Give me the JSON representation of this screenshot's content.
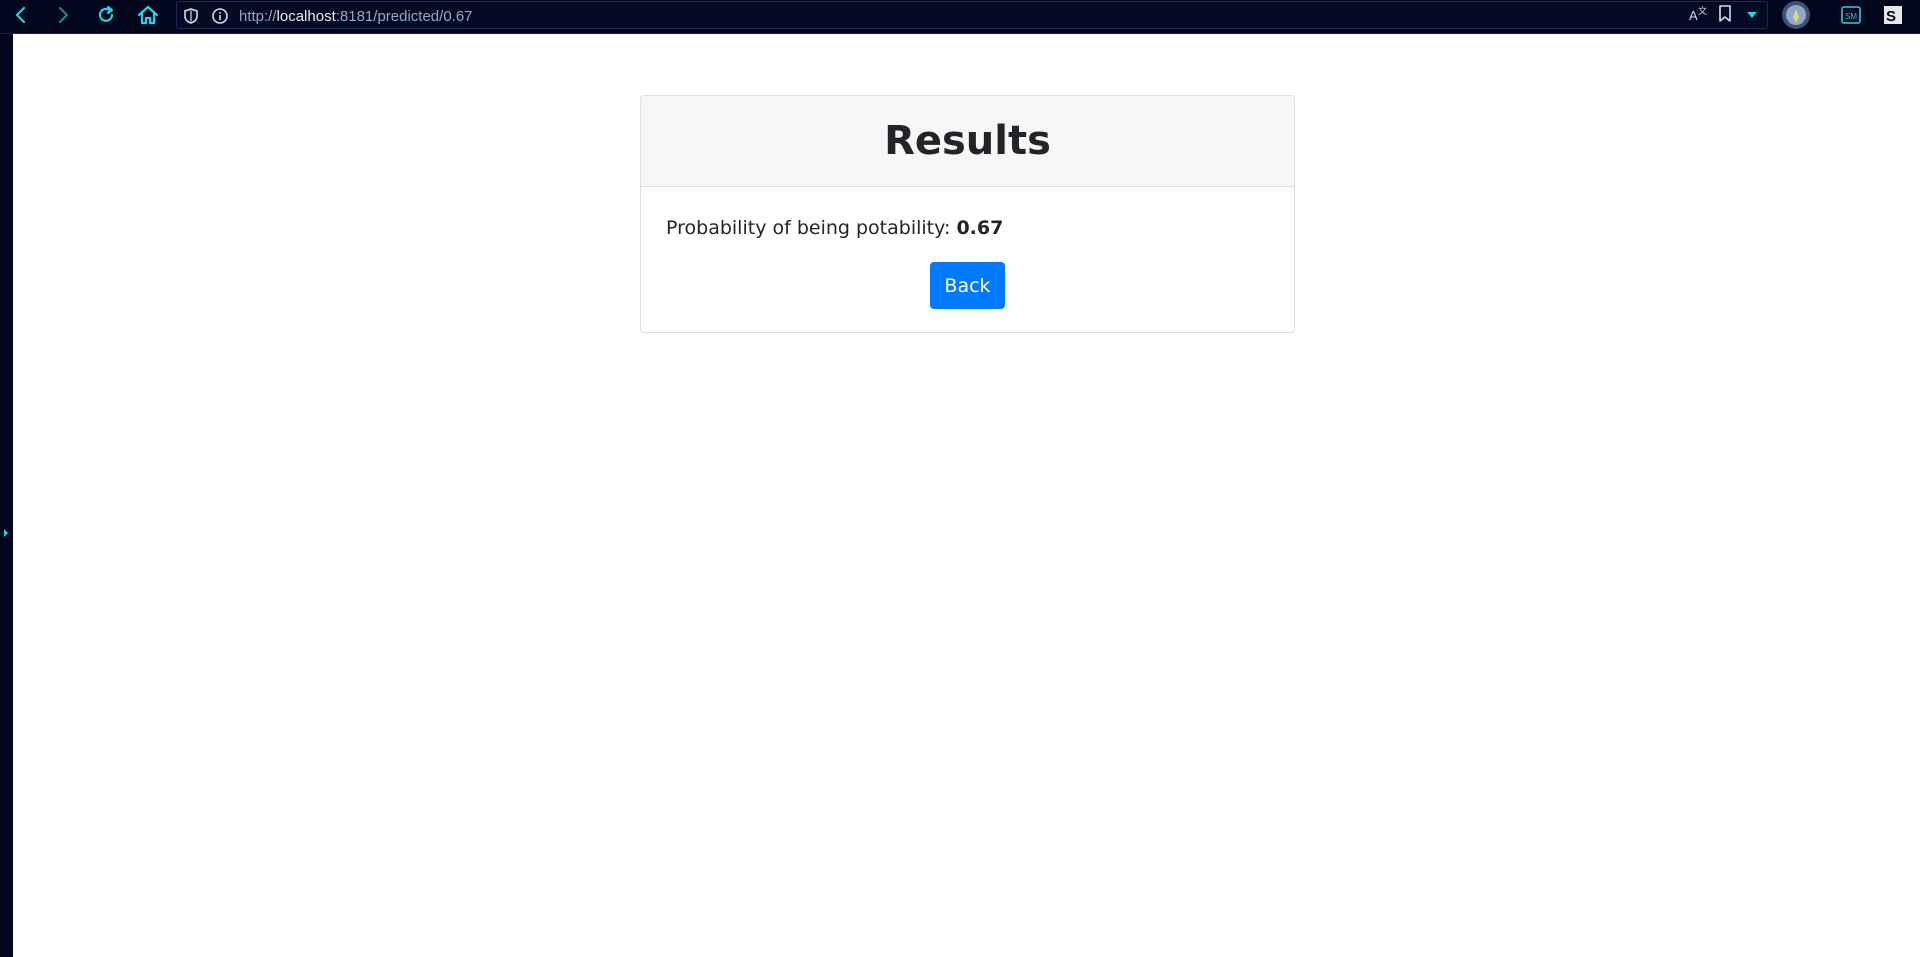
{
  "browser": {
    "url_scheme": "http://",
    "url_host": "localhost",
    "url_path": ":8181/predicted/0.67"
  },
  "icons": {
    "back": "back-arrow-icon",
    "forward": "forward-arrow-icon",
    "reload": "reload-icon",
    "home": "home-icon",
    "shield": "shield-icon",
    "info": "info-icon",
    "translate": "translate-icon",
    "bookmark": "bookmark-icon",
    "dropdown": "chevron-down-icon",
    "profile": "avatar",
    "extension1": "extension-icon",
    "extension2": "extension-icon"
  },
  "colors": {
    "chrome_bg": "#01061c",
    "accent": "#2bd1e6",
    "button_primary": "#007bff"
  },
  "card": {
    "title": "Results",
    "prob_label": "Probability of being potability: ",
    "prob_value": "0.67",
    "back_label": "Back"
  }
}
